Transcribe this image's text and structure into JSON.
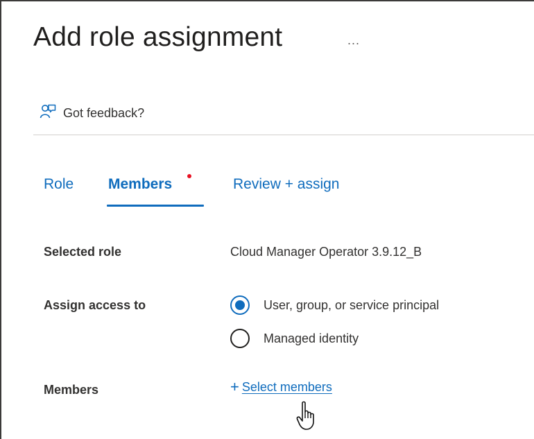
{
  "page": {
    "title": "Add role assignment",
    "more_label": "..."
  },
  "feedback": {
    "label": "Got feedback?",
    "icon": "feedback-person-icon"
  },
  "tabs": [
    {
      "label": "Role",
      "active": false
    },
    {
      "label": "Members",
      "active": true,
      "has_indicator": true
    },
    {
      "label": "Review + assign",
      "active": false
    }
  ],
  "form": {
    "selected_role": {
      "label": "Selected role",
      "value": "Cloud Manager Operator 3.9.12_B"
    },
    "assign_access": {
      "label": "Assign access to",
      "options": [
        {
          "label": "User, group, or service principal",
          "checked": true
        },
        {
          "label": "Managed identity",
          "checked": false
        }
      ]
    },
    "members": {
      "label": "Members",
      "link_label": "Select members",
      "icon": "plus-icon"
    }
  },
  "colors": {
    "accent": "#0f6cbd",
    "indicator": "#e81123",
    "text": "#323130"
  }
}
